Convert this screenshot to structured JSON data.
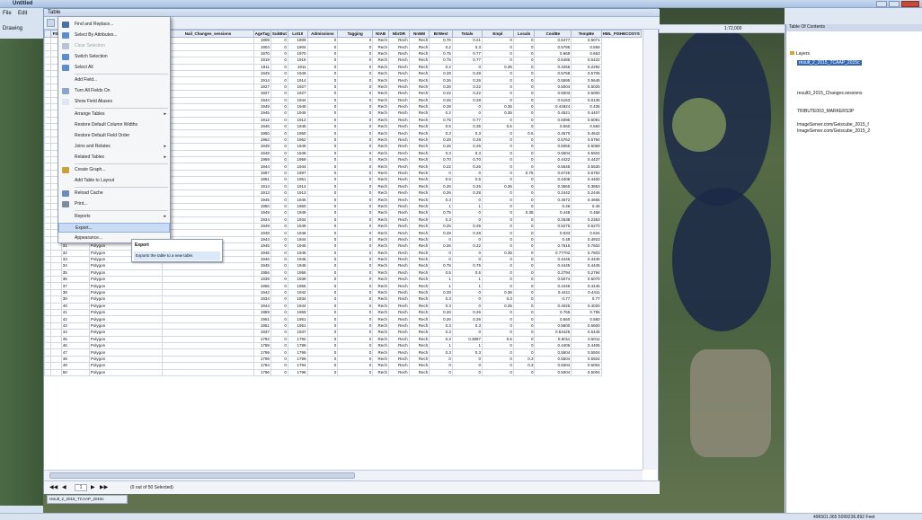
{
  "app": {
    "title": "Untitled"
  },
  "menu_bar": {
    "file": "File",
    "edit": "Edit"
  },
  "drawing_label": "Drawing",
  "table_window": {
    "title": "Table"
  },
  "columns": [
    "",
    "FID",
    "Shape",
    "Nail_TChanges",
    "Nail_Changes_sessions",
    "AgeTag",
    "SubBut",
    "Lot10",
    "Admissions",
    "Tagging",
    "NIAB",
    "NbrDR",
    "NnNM",
    "BrWest",
    "Totals",
    "Empl",
    "Locals",
    "CoolBe",
    "TempBe",
    "HML_FISHECOSYS"
  ],
  "rows": [
    [
      "",
      "0",
      "Polygon",
      "",
      "1909",
      "0",
      "1909",
      "0",
      "0",
      "Rech",
      "Rech",
      "Rech",
      "0.76",
      "0.21",
      "0",
      "0",
      "0.5477",
      "0.5071"
    ],
    [
      "",
      "1",
      "Polygon",
      "",
      "1904",
      "0",
      "1904",
      "0",
      "0",
      "Rech",
      "Rech",
      "Rech",
      "0.2",
      "0.3",
      "0",
      "0",
      "0.5785",
      "0.555"
    ],
    [
      "",
      "2",
      "Polygon",
      "",
      "1970",
      "0",
      "1970",
      "0",
      "0",
      "Rech",
      "Rech",
      "Rech",
      "0.75",
      "0.77",
      "0",
      "0",
      "0.669",
      "0.663"
    ],
    [
      "",
      "3",
      "Polygon",
      "",
      "1919",
      "0",
      "1919",
      "0",
      "0",
      "Rech",
      "Rech",
      "Rech",
      "0.75",
      "0.77",
      "0",
      "0",
      "0.5485",
      "0.5422"
    ],
    [
      "",
      "4",
      "Polygon",
      "",
      "1911",
      "0",
      "1911",
      "0",
      "0",
      "Rech",
      "Rech",
      "Rech",
      "0.2",
      "0",
      "0.35",
      "0",
      "0.2256",
      "0.2292"
    ],
    [
      "",
      "5",
      "Polygon",
      "",
      "1949",
      "0",
      "1949",
      "0",
      "0",
      "Rech",
      "Rech",
      "Rech",
      "0.28",
      "0.28",
      "0",
      "0",
      "0.5758",
      "0.5705"
    ],
    [
      "",
      "6",
      "Polygon",
      "",
      "1914",
      "0",
      "1914",
      "0",
      "0",
      "Rech",
      "Rech",
      "Rech",
      "0.26",
      "0.26",
      "0",
      "0",
      "0.5595",
      "0.5645"
    ],
    [
      "",
      "7",
      "Polygon",
      "",
      "1927",
      "0",
      "1927",
      "0",
      "0",
      "Rech",
      "Rech",
      "Rech",
      "0.26",
      "0.22",
      "0",
      "0",
      "0.5004",
      "0.5025"
    ],
    [
      "",
      "8",
      "Polygon",
      "",
      "1927",
      "0",
      "1927",
      "0",
      "0",
      "Rech",
      "Rech",
      "Rech",
      "0.22",
      "0.22",
      "0",
      "0",
      "0.5003",
      "0.5000"
    ],
    [
      "",
      "9",
      "Polygon",
      "",
      "1944",
      "0",
      "1944",
      "0",
      "0",
      "Rech",
      "Rech",
      "Rech",
      "0.26",
      "0.28",
      "0",
      "0",
      "0.5153",
      "0.5135"
    ],
    [
      "",
      "10",
      "Polygon",
      "",
      "1949",
      "0",
      "1949",
      "0",
      "0",
      "Rech",
      "Rech",
      "Rech",
      "0.28",
      "0",
      "0.35",
      "0",
      "0.44924",
      "0.435"
    ],
    [
      "",
      "11",
      "Polygon",
      "",
      "1945",
      "0",
      "1945",
      "0",
      "0",
      "Rech",
      "Rech",
      "Rech",
      "0.2",
      "0",
      "0.35",
      "0",
      "0.4521",
      "0.4407"
    ],
    [
      "",
      "12",
      "Polygon",
      "",
      "1912",
      "0",
      "1912",
      "0",
      "0",
      "Rech",
      "Rech",
      "Rech",
      "0.75",
      "0.77",
      "0",
      "0",
      "0.5095",
      "0.5091"
    ],
    [
      "",
      "13",
      "Polygon",
      "",
      "1945",
      "0",
      "1945",
      "0",
      "0",
      "Rech",
      "Rech",
      "Rech",
      "0.5",
      "0.35",
      "0.5",
      "0",
      "0.560",
      "0.560"
    ],
    [
      "",
      "14",
      "Polygon",
      "",
      "1950",
      "0",
      "1950",
      "0",
      "0",
      "Rech",
      "Rech",
      "Rech",
      "0.3",
      "0.3",
      "0",
      "0.5",
      "0.4570",
      "0.4642"
    ],
    [
      "",
      "15",
      "Polygon",
      "",
      "1962",
      "0",
      "1962",
      "0",
      "0",
      "Rech",
      "Rech",
      "Rech",
      "0.28",
      "0.28",
      "0",
      "0",
      "0.5762",
      "0.5794"
    ],
    [
      "",
      "16",
      "Polygon",
      "",
      "1949",
      "0",
      "1949",
      "0",
      "0",
      "Rech",
      "Rech",
      "Rech",
      "0.26",
      "0.26",
      "0",
      "0",
      "0.5065",
      "0.5059"
    ],
    [
      "",
      "17",
      "Polygon",
      "",
      "1948",
      "0",
      "1948",
      "0",
      "0",
      "Rech",
      "Rech",
      "Rech",
      "0.3",
      "0.3",
      "0",
      "0",
      "0.5504",
      "0.5504"
    ],
    [
      "",
      "18",
      "Polygon",
      "",
      "1959",
      "0",
      "1959",
      "0",
      "0",
      "Rech",
      "Rech",
      "Rech",
      "0.70",
      "0.70",
      "0",
      "0",
      "0.4422",
      "0.4437"
    ],
    [
      "",
      "19",
      "Polygon",
      "",
      "1944",
      "0",
      "1944",
      "0",
      "0",
      "Rech",
      "Rech",
      "Rech",
      "0.22",
      "0.26",
      "0",
      "0",
      "0.5545",
      "0.5530"
    ],
    [
      "",
      "20",
      "Polygon",
      "",
      "1997",
      "0",
      "1997",
      "0",
      "0",
      "Rech",
      "Rech",
      "Rech",
      "0",
      "0",
      "0",
      "0.75",
      "0.6725",
      "0.6792"
    ],
    [
      "",
      "21",
      "Polygon",
      "",
      "1951",
      "0",
      "1951",
      "0",
      "0",
      "Rech",
      "Rech",
      "Rech",
      "0.5",
      "0.5",
      "0",
      "0",
      "0.4408",
      "0.4400"
    ],
    [
      "",
      "22",
      "Polygon",
      "",
      "1914",
      "0",
      "1914",
      "0",
      "0",
      "Rech",
      "Rech",
      "Rech",
      "0.26",
      "0.26",
      "0.35",
      "0",
      "0.3565",
      "0.3863"
    ],
    [
      "",
      "23",
      "Polygon",
      "",
      "1913",
      "0",
      "1913",
      "0",
      "0",
      "Rech",
      "Rech",
      "Rech",
      "0.26",
      "0.28",
      "0",
      "0",
      "0.2442",
      "0.2446"
    ],
    [
      "",
      "24",
      "Polygon",
      "",
      "1945",
      "0",
      "1945",
      "0",
      "0",
      "Rech",
      "Rech",
      "Rech",
      "0.3",
      "0",
      "0",
      "0",
      "0.4672",
      "0.4655"
    ],
    [
      "",
      "25",
      "Polygon",
      "",
      "1950",
      "0",
      "1950",
      "0",
      "0",
      "Rech",
      "Rech",
      "Rech",
      "1",
      "1",
      "0",
      "0",
      "0.46",
      "0.46"
    ],
    [
      "",
      "26",
      "Polygon",
      "",
      "1949",
      "0",
      "1949",
      "0",
      "0",
      "Rech",
      "Rech",
      "Rech",
      "0.75",
      "0",
      "0",
      "0.35",
      "0.448",
      "0.468"
    ],
    [
      "",
      "27",
      "Polygon",
      "",
      "1934",
      "0",
      "1934",
      "0",
      "0",
      "Rech",
      "Rech",
      "Rech",
      "0.3",
      "0",
      "0",
      "0",
      "0.2538",
      "0.2353"
    ],
    [
      "",
      "28",
      "Polygon",
      "",
      "1949",
      "0",
      "1949",
      "0",
      "0",
      "Rech",
      "Rech",
      "Rech",
      "0.25",
      "0.25",
      "0",
      "0",
      "0.5275",
      "0.5270"
    ],
    [
      "",
      "29",
      "Polygon",
      "",
      "1948",
      "0",
      "1948",
      "0",
      "0",
      "Rech",
      "Rech",
      "Rech",
      "0.28",
      "0.28",
      "0",
      "0",
      "0.533",
      "0.534"
    ],
    [
      "",
      "30",
      "Polygon",
      "",
      "1944",
      "0",
      "1944",
      "0",
      "0",
      "Rech",
      "Rech",
      "Rech",
      "0",
      "0",
      "0",
      "0",
      "0.49",
      "0.4923"
    ],
    [
      "",
      "31",
      "Polygon",
      "",
      "1945",
      "0",
      "1945",
      "0",
      "0",
      "Rech",
      "Rech",
      "Rech",
      "0.26",
      "0.22",
      "0",
      "0",
      "0.7615",
      "0.7602"
    ],
    [
      "",
      "32",
      "Polygon",
      "",
      "1945",
      "0",
      "1945",
      "0",
      "0",
      "Rech",
      "Rech",
      "Rech",
      "0",
      "0",
      "0.35",
      "0",
      "0.77702",
      "0.7603"
    ],
    [
      "",
      "33",
      "Polygon",
      "",
      "1946",
      "0",
      "1946",
      "0",
      "0",
      "Rech",
      "Rech",
      "Rech",
      "0",
      "0",
      "0",
      "0",
      "0.4445",
      "0.4445"
    ],
    [
      "",
      "34",
      "Polygon",
      "",
      "1945",
      "0",
      "1945",
      "0",
      "0",
      "Rech",
      "Rech",
      "Rech",
      "0.75",
      "0.75",
      "0",
      "0",
      "0.4445",
      "0.4445"
    ],
    [
      "",
      "35",
      "Polygon",
      "",
      "1956",
      "0",
      "1956",
      "0",
      "0",
      "Rech",
      "Rech",
      "Rech",
      "0.5",
      "0.5",
      "0",
      "0",
      "0.2794",
      "0.2794"
    ],
    [
      "",
      "36",
      "Polygon",
      "",
      "1939",
      "0",
      "1939",
      "0",
      "0",
      "Rech",
      "Rech",
      "Rech",
      "1",
      "1",
      "0",
      "0",
      "0.5074",
      "0.5070"
    ],
    [
      "",
      "37",
      "Polygon",
      "",
      "1955",
      "0",
      "1955",
      "0",
      "0",
      "Rech",
      "Rech",
      "Rech",
      "1",
      "1",
      "0",
      "0",
      "0.4445",
      "0.4445"
    ],
    [
      "",
      "38",
      "Polygon",
      "",
      "1942",
      "0",
      "1942",
      "0",
      "0",
      "Rech",
      "Rech",
      "Rech",
      "0.28",
      "0",
      "0.35",
      "0",
      "0.4411",
      "0.4411"
    ],
    [
      "",
      "39",
      "Polygon",
      "",
      "1934",
      "0",
      "1934",
      "0",
      "0",
      "Rech",
      "Rech",
      "Rech",
      "0.3",
      "0",
      "0.3",
      "0",
      "0.77",
      "0.77"
    ],
    [
      "",
      "40",
      "Polygon",
      "",
      "1944",
      "0",
      "1944",
      "0",
      "0",
      "Rech",
      "Rech",
      "Rech",
      "0.3",
      "0",
      "0.35",
      "0",
      "0.4025",
      "0.4025"
    ],
    [
      "",
      "41",
      "Polygon",
      "",
      "1959",
      "0",
      "1959",
      "0",
      "0",
      "Rech",
      "Rech",
      "Rech",
      "0.26",
      "0.26",
      "0",
      "0",
      "0.755",
      "0.755"
    ],
    [
      "",
      "42",
      "Polygon",
      "",
      "1951",
      "0",
      "1951",
      "0",
      "0",
      "Rech",
      "Rech",
      "Rech",
      "0.26",
      "0.26",
      "0",
      "0",
      "0.560",
      "0.560"
    ],
    [
      "",
      "43",
      "Polygon",
      "",
      "1951",
      "0",
      "1951",
      "0",
      "0",
      "Rech",
      "Rech",
      "Rech",
      "0.3",
      "0.3",
      "0",
      "0",
      "0.5600",
      "0.5600"
    ],
    [
      "",
      "44",
      "Polygon",
      "",
      "1937",
      "0",
      "1937",
      "0",
      "0",
      "Rech",
      "Rech",
      "Rech",
      "0.3",
      "0",
      "0",
      "0",
      "0.54425",
      "0.5445"
    ],
    [
      "",
      "45",
      "Polygon",
      "",
      "1792",
      "0",
      "1792",
      "0",
      "0",
      "Rech",
      "Rech",
      "Rech",
      "0.3",
      "0.3997",
      "0.5",
      "0",
      "0.5011",
      "0.5011"
    ],
    [
      "",
      "46",
      "Polygon",
      "",
      "1789",
      "0",
      "1789",
      "0",
      "0",
      "Rech",
      "Rech",
      "Rech",
      "1",
      "1",
      "0",
      "0",
      "0.4406",
      "0.4406"
    ],
    [
      "",
      "47",
      "Polygon",
      "",
      "1799",
      "0",
      "1799",
      "0",
      "0",
      "Rech",
      "Rech",
      "Rech",
      "0.3",
      "0.3",
      "0",
      "0",
      "0.5504",
      "0.5504"
    ],
    [
      "",
      "48",
      "Polygon",
      "",
      "1799",
      "0",
      "1799",
      "0",
      "0",
      "Rech",
      "Rech",
      "Rech",
      "0",
      "0",
      "0",
      "0.3",
      "0.5504",
      "0.5504"
    ],
    [
      "",
      "49",
      "Polygon",
      "",
      "1794",
      "0",
      "1794",
      "0",
      "0",
      "Rech",
      "Rech",
      "Rech",
      "0",
      "0",
      "0",
      "0.3",
      "0.5004",
      "0.5004"
    ],
    [
      "",
      "50",
      "Polygon",
      "",
      "1796",
      "0",
      "1796",
      "0",
      "0",
      "Rech",
      "Rech",
      "Rech",
      "0",
      "0",
      "0",
      "0",
      "0.5004",
      "0.5004"
    ]
  ],
  "context_menu": {
    "items": [
      {
        "label": "Find and Replace...",
        "icon": "binoculars-icon",
        "color": "#4a6fa8"
      },
      {
        "label": "Select By Attributes...",
        "icon": "select-attributes-icon",
        "color": "#5b8dd1"
      },
      {
        "label": "Clear Selection",
        "icon": "clear-selection-icon",
        "color": "#b8c4d4",
        "dim": true
      },
      {
        "label": "Switch Selection",
        "icon": "switch-selection-icon",
        "color": "#5b8dd1"
      },
      {
        "label": "Select All",
        "icon": "select-all-icon",
        "color": "#5b8dd1"
      },
      {
        "label": "Add Field...",
        "icon": "add-field-icon",
        "color": ""
      },
      {
        "label": "Turn All Fields On",
        "icon": "fields-on-icon",
        "color": "#8aa6c8"
      },
      {
        "label": "Show Field Aliases",
        "icon": "check-icon",
        "color": "#dfe6f0"
      },
      {
        "label": "Arrange Tables",
        "icon": "",
        "color": "",
        "arrow": true
      },
      {
        "label": "Restore Default Column Widths",
        "icon": "",
        "color": ""
      },
      {
        "label": "Restore Default Field Order",
        "icon": "",
        "color": ""
      },
      {
        "label": "Joins and Relates",
        "icon": "",
        "color": "",
        "arrow": true
      },
      {
        "label": "Related Tables",
        "icon": "",
        "color": "",
        "arrow": true
      },
      {
        "label": "Create Graph...",
        "icon": "graph-icon",
        "color": "#c9a23a"
      },
      {
        "label": "Add Table to Layout",
        "icon": "",
        "color": ""
      },
      {
        "label": "Reload Cache",
        "icon": "reload-icon",
        "color": "#6c8db8"
      },
      {
        "label": "Print...",
        "icon": "print-icon",
        "color": "#7c8c9c"
      },
      {
        "label": "Reports",
        "icon": "",
        "color": "",
        "arrow": true
      },
      {
        "label": "Export...",
        "icon": "",
        "color": "",
        "highlight": true
      },
      {
        "label": "Appearance...",
        "icon": "",
        "color": ""
      }
    ]
  },
  "tooltip": {
    "title": "Export",
    "text": "Exports the table to a new table."
  },
  "navbar": {
    "record": "1",
    "status": "(0 out of 50 Selected)",
    "tab_label": "result_2_2015_TCAAP_2015c"
  },
  "toc": {
    "header": "Table Of Contents",
    "layers_label": "Layers",
    "items": [
      "result_2_2015_TCAAP_2015c",
      "result3_2015_Changes.sessions",
      "TRIBUTE003_MARKERS3P",
      "ImageServer.com/Geiscube_2015_f",
      "ImageServer.com/Geiscube_2015_2"
    ]
  },
  "scale_text": "1:72,000",
  "status_coords": "496501.365  5099236.892 Feet",
  "colors": {
    "accent": "#3367b8",
    "menu_highlight": "#c9dcf4"
  }
}
